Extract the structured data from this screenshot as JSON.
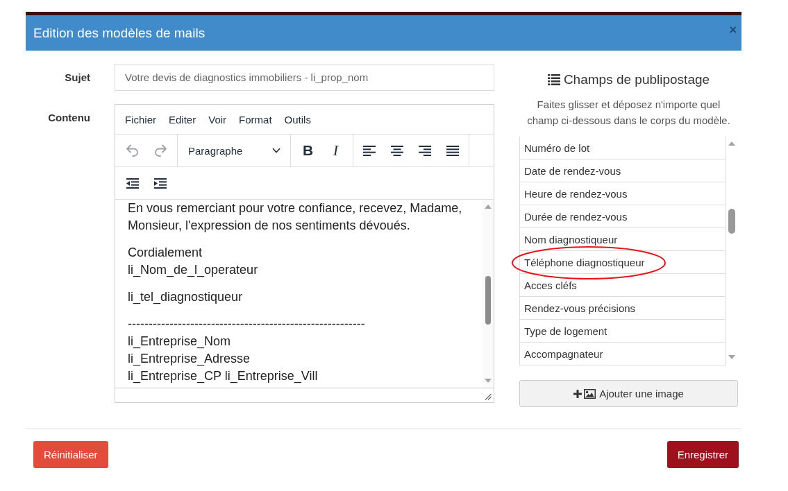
{
  "dialog": {
    "title": "Edition des modèles de mails",
    "close": "×"
  },
  "form": {
    "subject": {
      "label": "Sujet",
      "value": "Votre devis de diagnostics immobiliers - li_prop_nom"
    },
    "content": {
      "label": "Contenu"
    }
  },
  "editor": {
    "menu": [
      "Fichier",
      "Editer",
      "Voir",
      "Format",
      "Outils"
    ],
    "toolbar_rows": [
      [
        [
          {
            "kind": "undo",
            "disabled": true
          },
          {
            "kind": "redo",
            "disabled": true
          }
        ],
        [
          {
            "kind": "dropdown",
            "label": "Paragraphe",
            "disabled": false
          }
        ],
        [
          {
            "kind": "bold",
            "label": "B",
            "disabled": false
          },
          {
            "kind": "italic",
            "label": "I",
            "disabled": false
          }
        ],
        [
          {
            "kind": "align_left",
            "disabled": false
          },
          {
            "kind": "align_center",
            "disabled": false
          },
          {
            "kind": "align_right",
            "disabled": false
          },
          {
            "kind": "justify",
            "disabled": false
          }
        ]
      ],
      [
        [
          {
            "kind": "outdent",
            "disabled": false
          },
          {
            "kind": "indent",
            "disabled": false
          }
        ]
      ]
    ],
    "paragraphs": [
      [
        "En vous remerciant pour votre confiance, recevez, Madame, Monsieur, l'expression de nos sentiments dévoués."
      ],
      [
        "Cordialement",
        "li_Nom_de_l_operateur"
      ],
      [
        "li_tel_diagnostiqueur"
      ],
      [
        "---------------------------------------------------------",
        "li_Entreprise_Nom",
        "li_Entreprise_Adresse",
        "li_Entreprise_CP li_Entreprise_Vill"
      ]
    ]
  },
  "merge_fields": {
    "title": "Champs de publipostage",
    "description": "Faites glisser et déposez n'importe quel champ ci-dessous dans le corps du modèle.",
    "items": [
      {
        "label": "Numéro de lot",
        "circled": false
      },
      {
        "label": "Date de rendez-vous",
        "circled": false
      },
      {
        "label": "Heure de rendez-vous",
        "circled": false
      },
      {
        "label": "Durée de rendez-vous",
        "circled": false
      },
      {
        "label": "Nom diagnostiqueur",
        "circled": false
      },
      {
        "label": "Téléphone diagnostiqueur",
        "circled": true
      },
      {
        "label": "Acces cléfs",
        "circled": false
      },
      {
        "label": "Rendez-vous précisions",
        "circled": false
      },
      {
        "label": "Type de logement",
        "circled": false
      },
      {
        "label": "Accompagnateur",
        "circled": false
      }
    ],
    "add_image_button": "Ajouter une image"
  },
  "footer": {
    "buttons": [
      {
        "kind": "reset",
        "label": "Réinitialiser"
      },
      {
        "kind": "save",
        "label": "Enregistrer"
      }
    ]
  }
}
